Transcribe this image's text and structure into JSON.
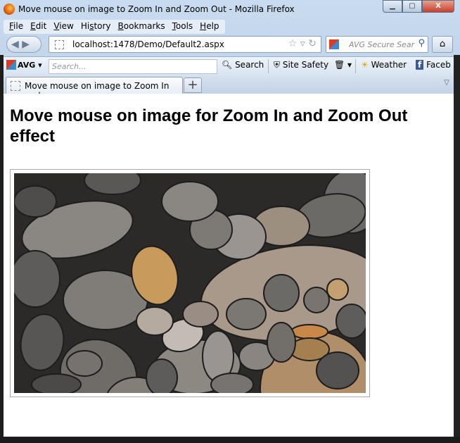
{
  "window": {
    "title": "Move mouse on image to Zoom In and Zoom Out - Mozilla Firefox",
    "controls": [
      "minimize",
      "maximize",
      "close"
    ]
  },
  "menu": [
    {
      "accel": "F",
      "rest": "ile"
    },
    {
      "accel": "E",
      "rest": "dit"
    },
    {
      "accel": "V",
      "rest": "iew"
    },
    {
      "pre": "Hi",
      "accel": "s",
      "rest": "tory"
    },
    {
      "accel": "B",
      "rest": "ookmarks"
    },
    {
      "accel": "T",
      "rest": "ools"
    },
    {
      "accel": "H",
      "rest": "elp"
    }
  ],
  "nav": {
    "url": "localhost:1478/Demo/Default2.aspx",
    "search_placeholder": "AVG Secure Sear"
  },
  "avg": {
    "logo": "AVG",
    "search_placeholder": "Search...",
    "search_label": "Search",
    "site_safety": "Site Safety",
    "weather": "Weather",
    "facebook": "Faceb"
  },
  "tabs": [
    {
      "label": "Move mouse on image to Zoom In and ...",
      "active": true
    }
  ],
  "page": {
    "heading": "Move mouse on image for Zoom In and Zoom Out effect"
  }
}
